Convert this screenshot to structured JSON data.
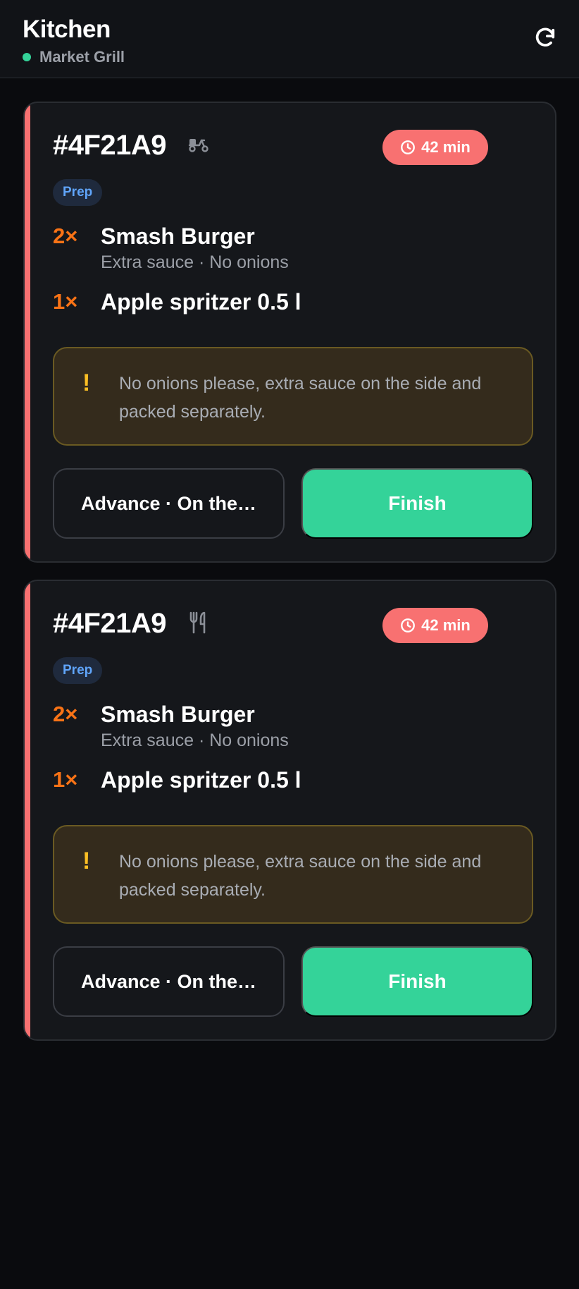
{
  "header": {
    "title": "Kitchen",
    "location": "Market Grill",
    "status_color": "#34d399",
    "refresh_icon": "refresh-icon"
  },
  "colors": {
    "accent_urgent": "#f87171",
    "finish": "#34d399",
    "status_blue": "#60a5fa",
    "qty_orange": "#f97316",
    "note_warning": "#fbbf24"
  },
  "orders": [
    {
      "id": "#4F21A9",
      "type_icon": "delivery-scooter-icon",
      "timer": "42 min",
      "status": "Prep",
      "items": [
        {
          "qty": "2×",
          "name": "Smash Burger",
          "mods": "Extra sauce · No onions"
        },
        {
          "qty": "1×",
          "name": "Apple spritzer 0.5 l",
          "mods": ""
        }
      ],
      "note_icon": "!",
      "note": "No onions please, extra sauce on the side and packed separately.",
      "advance_label": "Advance · On the…",
      "finish_label": "Finish"
    },
    {
      "id": "#4F21A9",
      "type_icon": "dine-in-utensils-icon",
      "timer": "42 min",
      "status": "Prep",
      "items": [
        {
          "qty": "2×",
          "name": "Smash Burger",
          "mods": "Extra sauce · No onions"
        },
        {
          "qty": "1×",
          "name": "Apple spritzer 0.5 l",
          "mods": ""
        }
      ],
      "note_icon": "!",
      "note": "No onions please, extra sauce on the side and packed separately.",
      "advance_label": "Advance · On the…",
      "finish_label": "Finish"
    }
  ]
}
